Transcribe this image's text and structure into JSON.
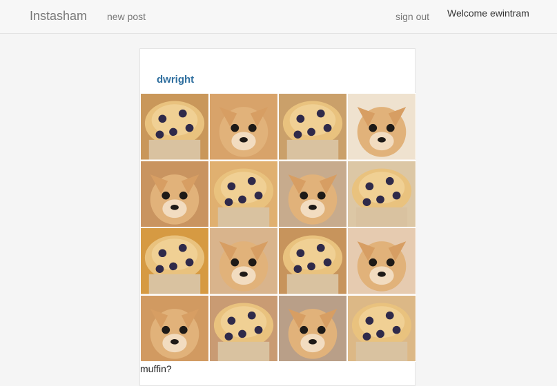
{
  "nav": {
    "brand": "Instasham",
    "new_post": "new post",
    "sign_out": "sign out",
    "welcome": "Welcome ewintram"
  },
  "post": {
    "author": "dwright",
    "caption": "muffin?",
    "tiles": [
      {
        "kind": "muffin",
        "bg": "#c9975a"
      },
      {
        "kind": "dog",
        "bg": "#d8a36a"
      },
      {
        "kind": "muffin",
        "bg": "#caa06a"
      },
      {
        "kind": "dog",
        "bg": "#efe2cf"
      },
      {
        "kind": "dog",
        "bg": "#c99460"
      },
      {
        "kind": "muffin",
        "bg": "#e0b070"
      },
      {
        "kind": "dog",
        "bg": "#c7ab8d"
      },
      {
        "kind": "muffin",
        "bg": "#dcc7a5"
      },
      {
        "kind": "muffin",
        "bg": "#d69a42"
      },
      {
        "kind": "dog",
        "bg": "#d9b48c"
      },
      {
        "kind": "muffin",
        "bg": "#c7945c"
      },
      {
        "kind": "dog",
        "bg": "#e6cbb0"
      },
      {
        "kind": "dog",
        "bg": "#d19a61"
      },
      {
        "kind": "muffin",
        "bg": "#c99b73"
      },
      {
        "kind": "dog",
        "bg": "#b99f88"
      },
      {
        "kind": "muffin",
        "bg": "#dcb886"
      }
    ]
  }
}
